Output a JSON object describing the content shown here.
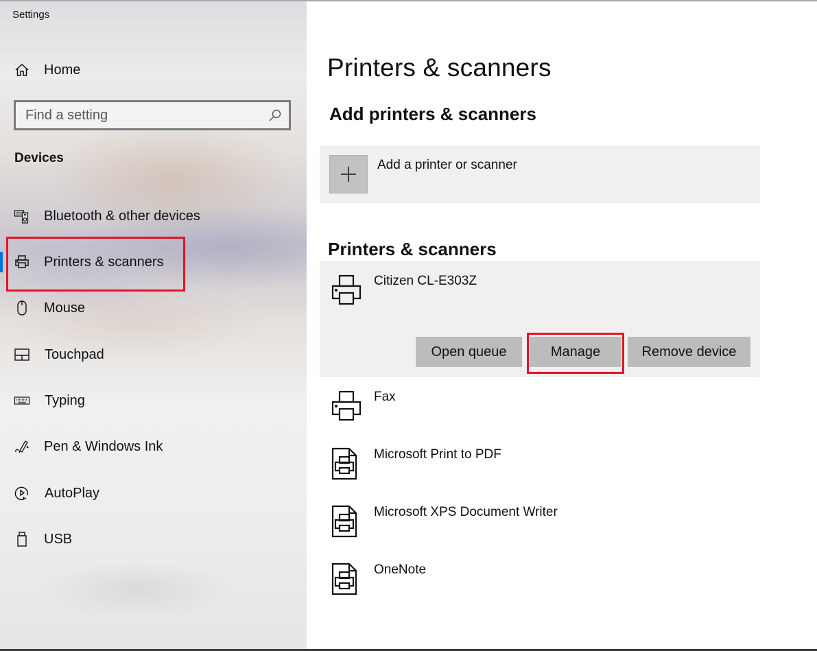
{
  "app": {
    "title": "Settings"
  },
  "sidebar": {
    "home_label": "Home",
    "search": {
      "placeholder": "Find a setting",
      "value": ""
    },
    "section_heading": "Devices",
    "items": [
      {
        "label": "Bluetooth & other devices",
        "icon": "bluetooth-devices-icon",
        "active": false
      },
      {
        "label": "Printers & scanners",
        "icon": "printer-icon",
        "active": true
      },
      {
        "label": "Mouse",
        "icon": "mouse-icon",
        "active": false
      },
      {
        "label": "Touchpad",
        "icon": "touchpad-icon",
        "active": false
      },
      {
        "label": "Typing",
        "icon": "keyboard-icon",
        "active": false
      },
      {
        "label": "Pen & Windows Ink",
        "icon": "pen-icon",
        "active": false
      },
      {
        "label": "AutoPlay",
        "icon": "autoplay-icon",
        "active": false
      },
      {
        "label": "USB",
        "icon": "usb-icon",
        "active": false
      }
    ]
  },
  "main": {
    "page_title": "Printers & scanners",
    "add_section": {
      "heading": "Add printers & scanners",
      "add_label": "Add a printer or scanner"
    },
    "list_section": {
      "heading": "Printers & scanners",
      "printers": [
        {
          "name": "Citizen CL-E303Z",
          "icon": "printer-icon",
          "selected": true,
          "actions": {
            "open_queue": "Open queue",
            "manage": "Manage",
            "remove": "Remove device"
          }
        },
        {
          "name": "Fax",
          "icon": "printer-icon",
          "selected": false
        },
        {
          "name": "Microsoft Print to PDF",
          "icon": "document-printer-icon",
          "selected": false
        },
        {
          "name": "Microsoft XPS Document Writer",
          "icon": "document-printer-icon",
          "selected": false
        },
        {
          "name": "OneNote",
          "icon": "document-printer-icon",
          "selected": false
        }
      ]
    }
  },
  "colors": {
    "accent": "#0078d7",
    "highlight_annotation": "#e81123",
    "row_background": "#f0f0f0",
    "button_background": "#bcbcbc"
  }
}
